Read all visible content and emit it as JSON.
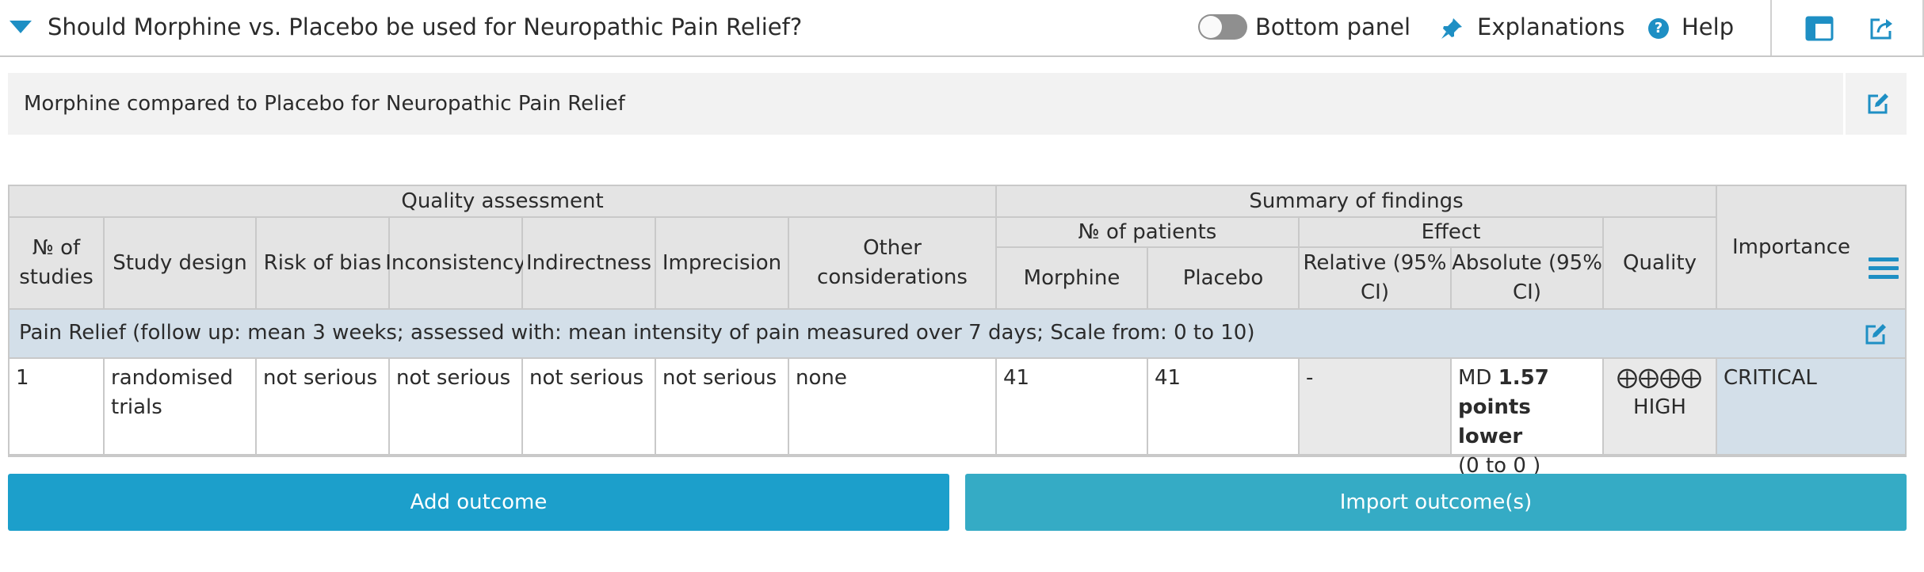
{
  "header": {
    "title": "Should Morphine vs. Placebo be used for Neuropathic Pain Relief?",
    "bottom_panel_label": "Bottom panel",
    "explanations_label": "Explanations",
    "help_label": "Help",
    "help_glyph": "?"
  },
  "subtitle": "Morphine compared to Placebo for Neuropathic Pain Relief",
  "table": {
    "groups": {
      "quality_assessment": "Quality assessment",
      "summary_of_findings": "Summary of findings",
      "num_patients": "№ of patients",
      "effect": "Effect"
    },
    "columns": {
      "num_studies": "№ of studies",
      "study_design": "Study design",
      "risk_of_bias": "Risk of bias",
      "inconsistency": "Inconsistency",
      "indirectness": "Indirectness",
      "imprecision": "Imprecision",
      "other_considerations": "Other considerations",
      "morphine": "Morphine",
      "placebo": "Placebo",
      "relative": "Relative (95% CI)",
      "absolute": "Absolute (95% CI)",
      "quality": "Quality",
      "importance": "Importance"
    },
    "outcome_title": "Pain Relief (follow up: mean 3 weeks; assessed with: mean intensity of pain measured over 7 days; Scale from: 0 to 10)",
    "row": {
      "num_studies": "1",
      "study_design": "randomised trials",
      "risk_of_bias": "not serious",
      "inconsistency": "not serious",
      "indirectness": "not serious",
      "imprecision": "not serious",
      "other_considerations": "none",
      "morphine": "41",
      "placebo": "41",
      "relative": "-",
      "absolute_prefix": "MD ",
      "absolute_bold": "1.57 points lower",
      "absolute_ci": "(0 to 0 )",
      "quality_symbols": "⨁⨁⨁⨁",
      "quality_label": "HIGH",
      "importance": "CRITICAL"
    }
  },
  "buttons": {
    "add_outcome": "Add outcome",
    "import_outcomes": "Import outcome(s)"
  },
  "colors": {
    "accent": "#1e8fc4",
    "add_button": "#1c9fcb",
    "import_button": "#35abc5",
    "outcome_row": "#d3dfe9",
    "header_cell": "#e4e4e4"
  },
  "icons": [
    "collapse-triangle-icon",
    "toggle-switch",
    "pin-icon",
    "help-icon",
    "layout-icon",
    "export-icon",
    "edit-icon",
    "menu-icon"
  ]
}
